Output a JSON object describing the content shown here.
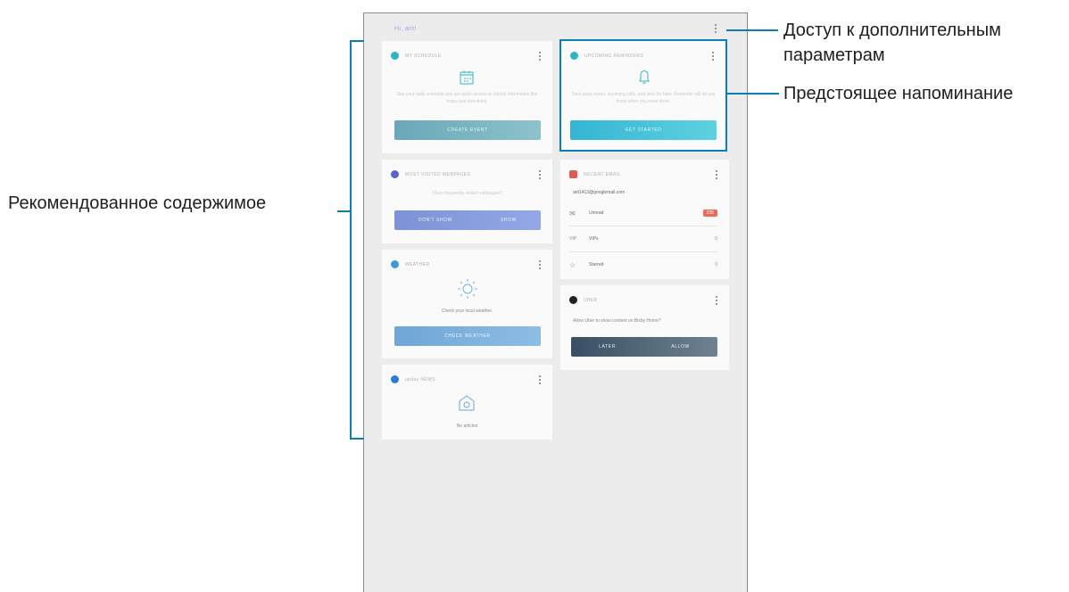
{
  "header": {
    "greeting": "Hi, ant!"
  },
  "cards": {
    "schedule": {
      "title": "MY SCHEDULE",
      "desc": "See your daily schedule and get quick access to helpful information like maps and directions.",
      "button": "CREATE EVENT",
      "icon": "calendar-icon",
      "color": "#2bb5c6"
    },
    "reminders": {
      "title": "UPCOMING REMINDERS",
      "desc": "Tuck away notes, incoming calls, and links for later. Reminder will let you know when you need them.",
      "button": "GET STARTED",
      "icon": "bell-icon",
      "color": "#2bb5c6"
    },
    "webpages": {
      "title": "MOST VISITED WEBPAGES",
      "desc": "Show frequently visited webpages?",
      "btn_left": "DON'T SHOW",
      "btn_right": "SHOW",
      "color": "#5b63c9"
    },
    "email": {
      "title": "RECENT EMAIL",
      "account": "ant1413@googlemail.com",
      "rows": [
        {
          "icon": "mail-icon",
          "label": "Unread",
          "count": "235"
        },
        {
          "icon": "vip-icon",
          "label": "VIPs",
          "count": "0"
        },
        {
          "icon": "star-icon",
          "label": "Starred",
          "count": "0"
        }
      ],
      "color": "#e05a4f",
      "vip_text": "VIP"
    },
    "weather": {
      "title": "WEATHER",
      "desc": "Check your local weather.",
      "button": "CHECK WEATHER",
      "icon": "sun-icon",
      "color": "#3a9ad9"
    },
    "uber": {
      "title": "UBER",
      "desc": "Allow Uber to show content on Bixby Home?",
      "btn_left": "LATER",
      "btn_right": "ALLOW",
      "color": "#222222"
    },
    "news": {
      "title": "upday NEWS",
      "desc": "No articles",
      "icon": "news-icon",
      "color": "#2a7bd6"
    }
  },
  "callouts": {
    "more_options": [
      "Доступ к дополнительным",
      "параметрам"
    ],
    "reminder": "Предстоящее напоминание",
    "recommended": "Рекомендованное содержимое"
  }
}
